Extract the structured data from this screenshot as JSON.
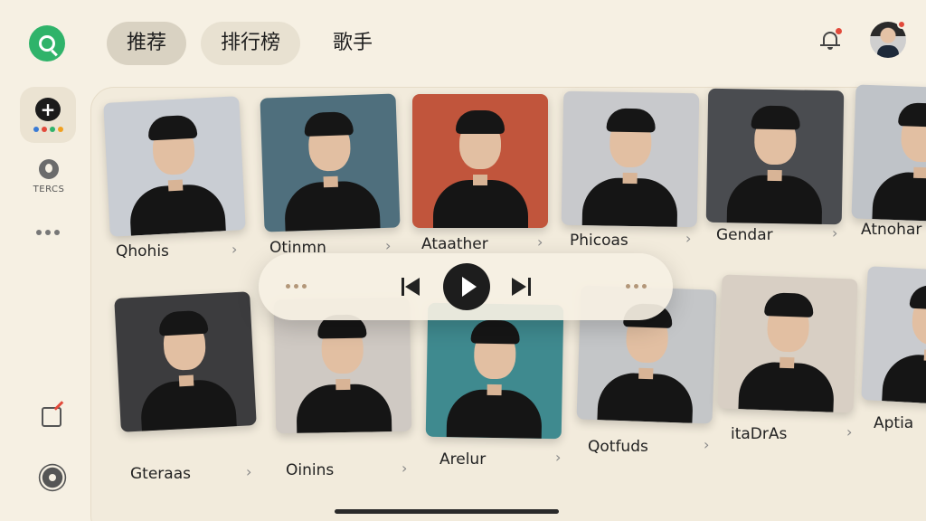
{
  "sidebar": {
    "apple_label": "TERCS"
  },
  "tabs": [
    {
      "label": "推荐"
    },
    {
      "label": "排行榜"
    },
    {
      "label": "歌手"
    }
  ],
  "colors": {
    "accent": "#2fb36a",
    "notification": "#e24a3b",
    "background": "#f6f0e3",
    "dots": [
      "#3a7bd5",
      "#e24a3b",
      "#2fb36a",
      "#f0a020"
    ]
  },
  "artists_row1": [
    {
      "name": "Qhohis",
      "bg": "#c9cdd3"
    },
    {
      "name": "Otinmn",
      "bg": "#4f6f7d"
    },
    {
      "name": "Ataather",
      "bg": "#c1553c"
    },
    {
      "name": "Phicoas",
      "bg": "#c8c9cc"
    },
    {
      "name": "Gendar",
      "bg": "#4a4c50"
    },
    {
      "name": "Atnohar",
      "bg": "#bfc3c8"
    }
  ],
  "artists_row2": [
    {
      "name": "Gteraas",
      "bg": "#3c3c3e"
    },
    {
      "name": "Oinins",
      "bg": "#cfc9c3"
    },
    {
      "name": "Arelur",
      "bg": "#3f8a8f"
    },
    {
      "name": "Qotfuds",
      "bg": "#c4c6c8"
    },
    {
      "name": "itaDrAs",
      "bg": "#d8cfc4"
    },
    {
      "name": "Aptia",
      "bg": "#c9cbcf"
    }
  ],
  "player": {
    "state": "paused"
  }
}
